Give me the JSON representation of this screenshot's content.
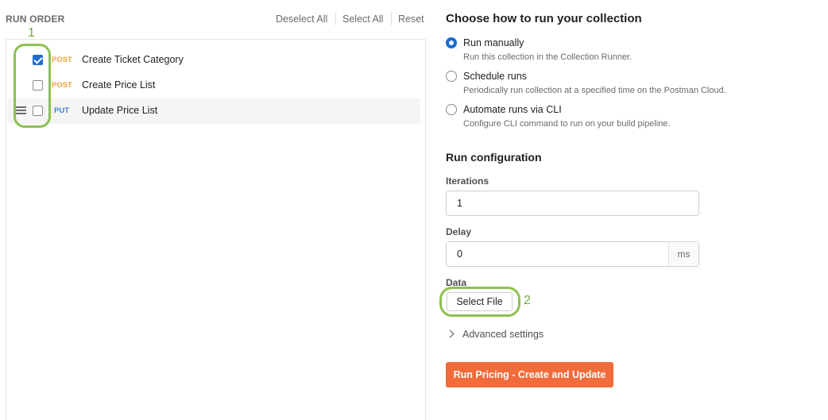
{
  "left_panel": {
    "title": "RUN ORDER",
    "actions": {
      "deselect_all": "Deselect All",
      "select_all": "Select All",
      "reset": "Reset"
    },
    "requests": [
      {
        "method": "POST",
        "name": "Create Ticket Category",
        "checked": true
      },
      {
        "method": "POST",
        "name": "Create Price List",
        "checked": false
      },
      {
        "method": "PUT",
        "name": "Update Price List",
        "checked": false
      }
    ]
  },
  "annotations": {
    "label_1": "1",
    "label_2": "2"
  },
  "right_panel": {
    "title": "Choose how to run your collection",
    "run_modes": [
      {
        "label": "Run manually",
        "desc": "Run this collection in the Collection Runner.",
        "selected": true
      },
      {
        "label": "Schedule runs",
        "desc": "Periodically run collection at a specified time on the Postman Cloud.",
        "selected": false
      },
      {
        "label": "Automate runs via CLI",
        "desc": "Configure CLI command to run on your build pipeline.",
        "selected": false
      }
    ],
    "config": {
      "title": "Run configuration",
      "iterations_label": "Iterations",
      "iterations_value": "1",
      "delay_label": "Delay",
      "delay_value": "0",
      "delay_unit": "ms",
      "data_label": "Data",
      "select_file": "Select File",
      "advanced": "Advanced settings",
      "run_button": "Run Pricing - Create and Update"
    }
  },
  "colors": {
    "accent": "#1c6bd1",
    "run_button": "#f26b3a",
    "post": "#e8a33c",
    "put": "#3f7fd4",
    "annotation": "#8cc152"
  },
  "icons": [
    "checkbox",
    "drag-handle-icon",
    "radio",
    "chevron-right-icon"
  ]
}
